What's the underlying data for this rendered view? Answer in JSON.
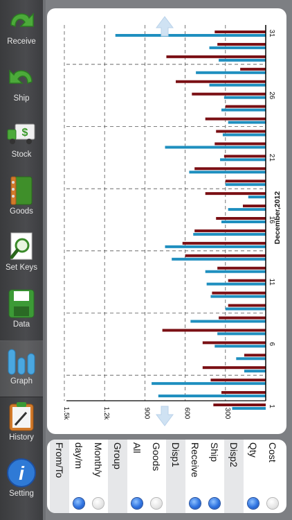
{
  "sidebar": {
    "items": [
      {
        "label": "Receive",
        "icon": "receive-arrow-icon",
        "selected": false
      },
      {
        "label": "Ship",
        "icon": "ship-arrow-icon",
        "selected": false
      },
      {
        "label": "Stock",
        "icon": "stock-truck-icon",
        "selected": false
      },
      {
        "label": "Goods",
        "icon": "goods-notebook-icon",
        "selected": false
      },
      {
        "label": "Set Keys",
        "icon": "set-keys-magnifier-icon",
        "selected": false
      },
      {
        "label": "Data",
        "icon": "data-floppy-icon",
        "selected": false
      },
      {
        "label": "Graph",
        "icon": "graph-bars-icon",
        "selected": true
      },
      {
        "label": "History",
        "icon": "history-clipboard-icon",
        "selected": false
      },
      {
        "label": "Setting",
        "icon": "info-icon",
        "selected": false
      }
    ]
  },
  "options": {
    "from_to_label": "From/To",
    "day_m_label": "day/m",
    "month_y_label": "Month/y",
    "group_label": "Group",
    "all_label": "All",
    "goods_label": "Goods",
    "disp1_label": "Disp1",
    "receive_label": "Receive",
    "ship_label": "Ship",
    "disp2_label": "Disp2",
    "qty_label": "Qty",
    "cost_label": "Cost",
    "selected": {
      "period": "day/m",
      "group": "All",
      "disp1": [
        "Receive",
        "Ship"
      ],
      "disp2": "Qty"
    }
  },
  "colors": {
    "receive": "#1f8fbf",
    "ship": "#7a0f14",
    "radio_on": "#2f73e0"
  },
  "chart_data": {
    "type": "bar",
    "orientation": "horizontal",
    "xlabel": "December,2012",
    "x": [
      1,
      2,
      3,
      4,
      5,
      6,
      7,
      8,
      9,
      10,
      11,
      12,
      13,
      14,
      15,
      16,
      17,
      18,
      19,
      20,
      21,
      22,
      23,
      24,
      25,
      26,
      27,
      28,
      29,
      30,
      31
    ],
    "x_tick_labels": [
      "1",
      "6",
      "11",
      "16",
      "21",
      "26",
      "31"
    ],
    "y_tick_labels": [
      "300",
      "600",
      "900",
      "1.2k",
      "1.5k"
    ],
    "ylim": [
      0,
      1500
    ],
    "grid": true,
    "series": [
      {
        "key": "receive",
        "values": [
          250,
          800,
          850,
          160,
          220,
          380,
          360,
          560,
          300,
          410,
          440,
          450,
          700,
          750,
          540,
          330,
          280,
          130,
          300,
          570,
          340,
          750,
          320,
          280,
          330,
          310,
          420,
          520,
          350,
          420,
          1120
        ]
      },
      {
        "key": "ship",
        "values": [
          390,
          330,
          410,
          470,
          160,
          470,
          770,
          350,
          280,
          400,
          280,
          360,
          600,
          620,
          530,
          370,
          170,
          450,
          300,
          530,
          310,
          380,
          370,
          450,
          300,
          550,
          670,
          190,
          740,
          360,
          380
        ]
      }
    ]
  }
}
